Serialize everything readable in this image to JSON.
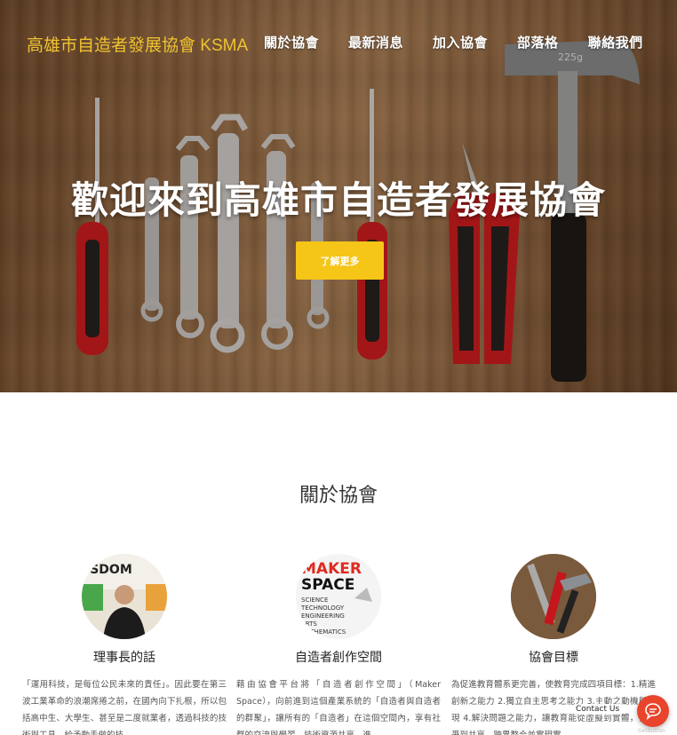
{
  "header": {
    "brand": "高雄市自造者發展協會 KSMA",
    "nav": [
      "關於協會",
      "最新消息",
      "加入協會",
      "部落格",
      "聯絡我們"
    ]
  },
  "hero": {
    "title": "歡迎來到高雄市自造者發展協會",
    "cta_label": "了解更多",
    "hammer_marking": "225g"
  },
  "about": {
    "title": "關於協會",
    "columns": [
      {
        "title": "理事長的話",
        "image_icon": "chairman-photo",
        "text": "「運用科技，是每位公民未來的責任」。因此要在第三波工業革命的浪潮席捲之前，在國內向下扎根，所以包括高中生、大學生、甚至是二度就業者，透過科技的技術與工具，給予動手做的技"
      },
      {
        "title": "自造者創作空間",
        "image_icon": "maker-space-logo",
        "logo_lines": [
          "MAKER",
          "SPACE"
        ],
        "logo_steam": [
          "SCIENCE",
          "TECHNOLOGY",
          "ENGINEERING",
          "ARTS",
          "MATHEMATICS"
        ],
        "text": "藉由協會平台將「自造者創作空間」（Maker Space），向前進到這個產業系統的「自造者與自造者的群聚」，讓所有的「自造者」在這個空間內，享有社群的交流與學習、技術資源共享，進"
      },
      {
        "title": "協會目標",
        "image_icon": "tools-photo",
        "text": "為促進教育體系更完善，使教育完成四項目標：1.精進創新之能力 2.獨立自主思考之能力 3.主動之動機與實現 4.解決問題之能力，讓教育能從虛擬到實體，從競爭到共享，跨界整合並實現實"
      }
    ]
  },
  "contact_widget": {
    "label": "Contact Us",
    "icon": "chat-icon",
    "credit": "GetButton"
  },
  "colors": {
    "brand_yellow": "#f0c330",
    "cta_yellow": "#f5c518",
    "contact_red": "#e8452c"
  }
}
